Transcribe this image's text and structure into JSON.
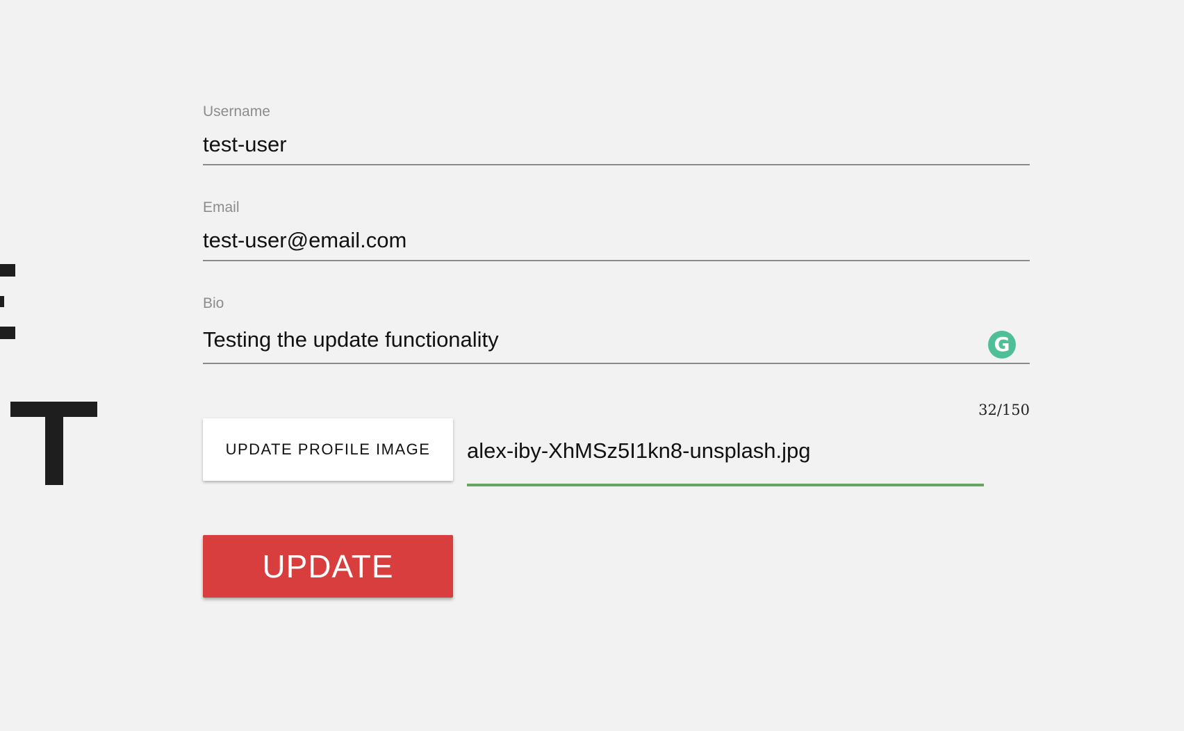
{
  "side_heading": {
    "letters": [
      "E",
      "T"
    ]
  },
  "form": {
    "username": {
      "label": "Username",
      "value": "test-user"
    },
    "email": {
      "label": "Email",
      "value": "test-user@email.com"
    },
    "bio": {
      "label": "Bio",
      "value": "Testing the update functionality",
      "counter": "32/150",
      "assistant_icon": "grammarly-icon",
      "assistant_glyph": "G"
    },
    "upload": {
      "button_label": "UPDATE PROFILE IMAGE",
      "filename": "alex-iby-XhMSz5I1kn8-unsplash.jpg"
    },
    "submit_label": "UPDATE"
  },
  "colors": {
    "background": "#f2f2f2",
    "primary": "#d83e3e",
    "success_underline": "#66a65e",
    "grammarly": "#4fbf97"
  }
}
